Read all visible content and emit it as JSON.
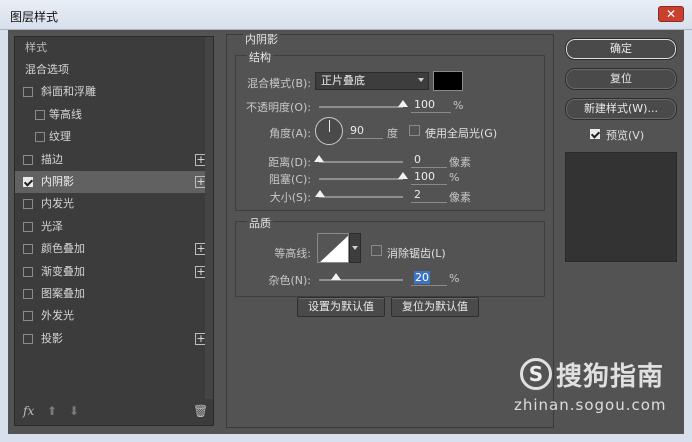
{
  "window": {
    "title": "图层样式",
    "close": "✕"
  },
  "styles_panel": {
    "header": "样式",
    "items": [
      {
        "label": "混合选项",
        "checkbox": false,
        "plus": false,
        "checked": false,
        "sub": false
      },
      {
        "label": "斜面和浮雕",
        "checkbox": true,
        "plus": false,
        "checked": false,
        "sub": false
      },
      {
        "label": "等高线",
        "checkbox": true,
        "plus": false,
        "checked": false,
        "sub": true
      },
      {
        "label": "纹理",
        "checkbox": true,
        "plus": false,
        "checked": false,
        "sub": true
      },
      {
        "label": "描边",
        "checkbox": true,
        "plus": true,
        "checked": false,
        "sub": false
      },
      {
        "label": "内阴影",
        "checkbox": true,
        "plus": true,
        "checked": true,
        "sub": false,
        "selected": true
      },
      {
        "label": "内发光",
        "checkbox": true,
        "plus": false,
        "checked": false,
        "sub": false
      },
      {
        "label": "光泽",
        "checkbox": true,
        "plus": false,
        "checked": false,
        "sub": false
      },
      {
        "label": "颜色叠加",
        "checkbox": true,
        "plus": true,
        "checked": false,
        "sub": false
      },
      {
        "label": "渐变叠加",
        "checkbox": true,
        "plus": true,
        "checked": false,
        "sub": false
      },
      {
        "label": "图案叠加",
        "checkbox": true,
        "plus": false,
        "checked": false,
        "sub": false
      },
      {
        "label": "外发光",
        "checkbox": true,
        "plus": false,
        "checked": false,
        "sub": false
      },
      {
        "label": "投影",
        "checkbox": true,
        "plus": true,
        "checked": false,
        "sub": false
      }
    ],
    "footer": {
      "fx": "fx",
      "up": "⬆",
      "down": "⬇",
      "trash": "🗑"
    }
  },
  "inner_shadow": {
    "section_title": "内阴影",
    "structure": {
      "title": "结构",
      "blend_mode_label": "混合模式(B):",
      "blend_mode_value": "正片叠底",
      "color": "#000000",
      "opacity_label": "不透明度(O):",
      "opacity_value": "100",
      "opacity_unit": "%",
      "opacity_fraction": 1.0,
      "angle_label": "角度(A):",
      "angle_value": "90",
      "angle_unit": "度",
      "global_light_label": "使用全局光(G)",
      "distance_label": "距离(D):",
      "distance_value": "0",
      "distance_unit": "像素",
      "distance_fraction": 0.0,
      "choke_label": "阻塞(C):",
      "choke_value": "100",
      "choke_unit": "%",
      "choke_fraction": 1.0,
      "size_label": "大小(S):",
      "size_value": "2",
      "size_unit": "像素",
      "size_fraction": 0.01
    },
    "quality": {
      "title": "品质",
      "contour_label": "等高线:",
      "antialias_label": "消除锯齿(L)",
      "noise_label": "杂色(N):",
      "noise_value": "20",
      "noise_unit": "%",
      "noise_fraction": 0.2
    },
    "make_default": "设置为默认值",
    "reset_default": "复位为默认值"
  },
  "actions": {
    "ok": "确定",
    "reset": "复位",
    "new_style": "新建样式(W)...",
    "preview_label": "预览(V)"
  },
  "watermark": {
    "logo": "S",
    "name": "搜狗指南",
    "url": "zhinan.sogou.com"
  }
}
